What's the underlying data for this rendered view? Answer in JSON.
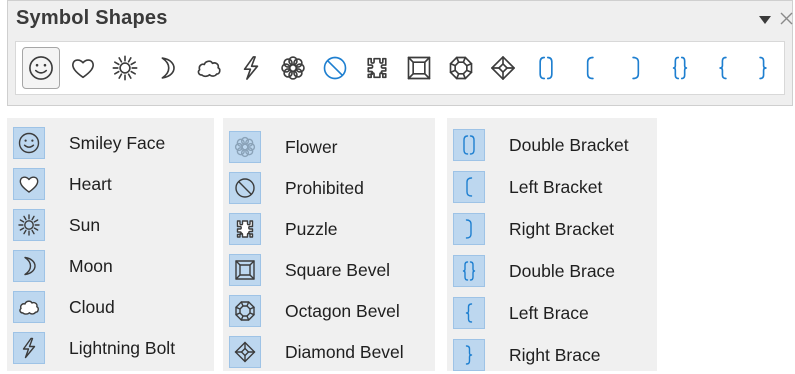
{
  "toolbar": {
    "title": "Symbol Shapes",
    "menu_icon": "dropdown-arrow-icon",
    "close_icon": "close-icon",
    "buttons": [
      {
        "id": "smiley-face",
        "icon": "smiley-face-icon",
        "selected": true
      },
      {
        "id": "heart",
        "icon": "heart-icon"
      },
      {
        "id": "sun",
        "icon": "sun-icon"
      },
      {
        "id": "moon",
        "icon": "moon-icon"
      },
      {
        "id": "cloud",
        "icon": "cloud-icon"
      },
      {
        "id": "lightning-bolt",
        "icon": "lightning-bolt-icon"
      },
      {
        "id": "flower",
        "icon": "flower-icon"
      },
      {
        "id": "prohibited",
        "icon": "prohibited-icon"
      },
      {
        "id": "puzzle",
        "icon": "puzzle-icon"
      },
      {
        "id": "square-bevel",
        "icon": "square-bevel-icon"
      },
      {
        "id": "octagon-bevel",
        "icon": "octagon-bevel-icon"
      },
      {
        "id": "diamond-bevel",
        "icon": "diamond-bevel-icon"
      },
      {
        "id": "double-bracket",
        "icon": "double-bracket-icon"
      },
      {
        "id": "left-bracket",
        "icon": "left-bracket-icon"
      },
      {
        "id": "right-bracket",
        "icon": "right-bracket-icon"
      },
      {
        "id": "double-brace",
        "icon": "double-brace-icon"
      },
      {
        "id": "left-brace",
        "icon": "left-brace-icon"
      },
      {
        "id": "right-brace",
        "icon": "right-brace-icon"
      }
    ]
  },
  "menus": [
    {
      "items": [
        {
          "label": "Smiley Face",
          "icon": "smiley-face-icon"
        },
        {
          "label": "Heart",
          "icon": "heart-icon"
        },
        {
          "label": "Sun",
          "icon": "sun-icon"
        },
        {
          "label": "Moon",
          "icon": "moon-icon"
        },
        {
          "label": "Cloud",
          "icon": "cloud-icon"
        },
        {
          "label": "Lightning Bolt",
          "icon": "lightning-bolt-icon"
        }
      ]
    },
    {
      "items": [
        {
          "label": "Flower",
          "icon": "flower-icon"
        },
        {
          "label": "Prohibited",
          "icon": "prohibited-icon"
        },
        {
          "label": "Puzzle",
          "icon": "puzzle-icon"
        },
        {
          "label": "Square Bevel",
          "icon": "square-bevel-icon"
        },
        {
          "label": "Octagon Bevel",
          "icon": "octagon-bevel-icon"
        },
        {
          "label": "Diamond Bevel",
          "icon": "diamond-bevel-icon"
        }
      ]
    },
    {
      "items": [
        {
          "label": "Double Bracket",
          "icon": "double-bracket-icon"
        },
        {
          "label": "Left Bracket",
          "icon": "left-bracket-icon"
        },
        {
          "label": "Right Bracket",
          "icon": "right-bracket-icon"
        },
        {
          "label": "Double Brace",
          "icon": "double-brace-icon"
        },
        {
          "label": "Left Brace",
          "icon": "left-brace-icon"
        },
        {
          "label": "Right Brace",
          "icon": "right-brace-icon"
        }
      ]
    }
  ],
  "colors": {
    "icon_gray": "#3c3c3c",
    "icon_blue": "#1e7fd0",
    "highlight": "#bdd7ef"
  }
}
